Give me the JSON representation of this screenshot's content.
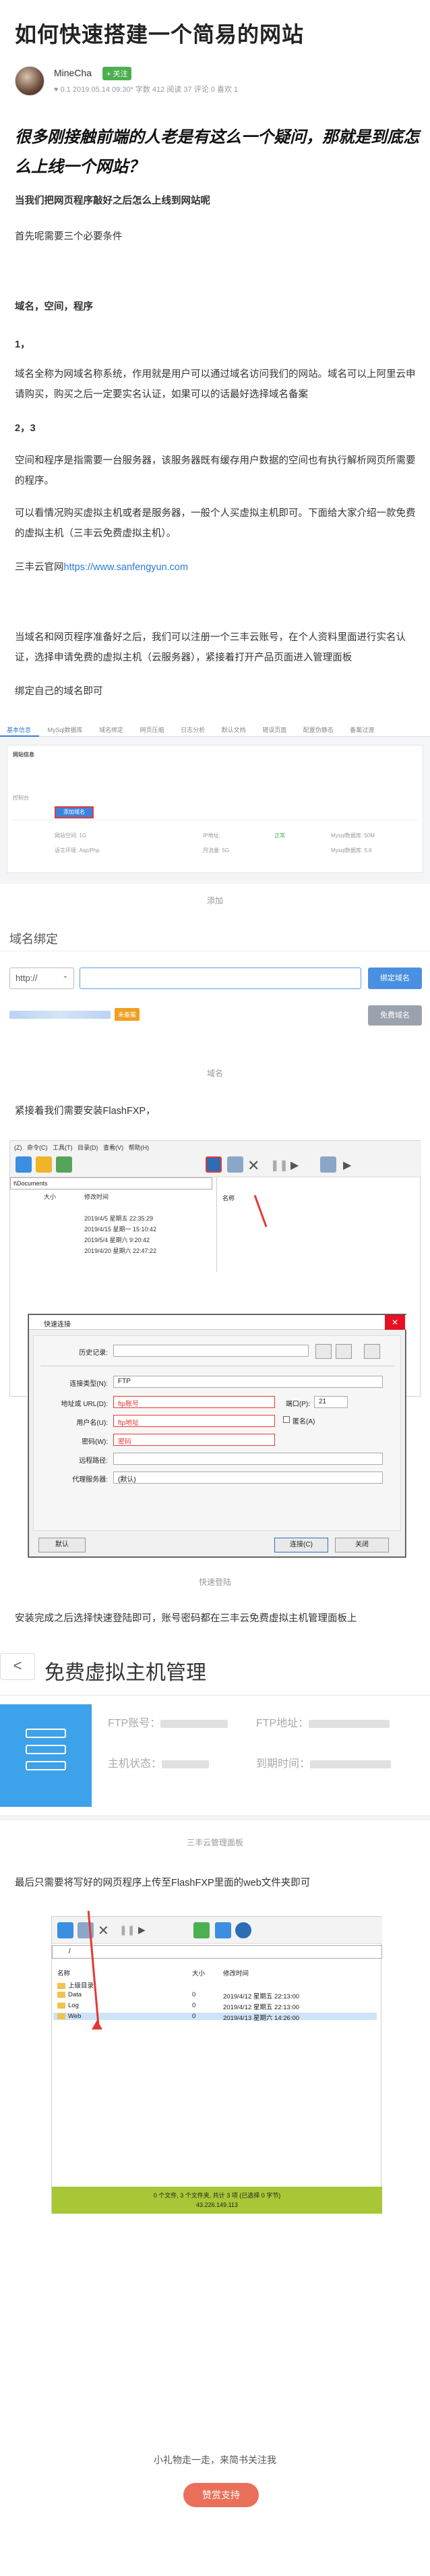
{
  "article": {
    "title": "如何快速搭建一个简易的网站",
    "author": "MineCha",
    "follow_label": "+ 关注",
    "meta": "♥ 0.1  2019.05.14 09:30* 字数 412  阅读 37 评论 0 喜欢 1",
    "lead": "很多刚接触前端的人老是有这么一个疑问，那就是到底怎么上线一个网站？",
    "subhead": "当我们把网页程序敲好之后怎么上线到网站呢",
    "p_need": "首先呢需要三个必要条件",
    "p_list": "域名，空间，程序",
    "p_1": "1，",
    "p_domain": "域名全称为网域名称系统，作用就是用户可以通过域名访问我们的网站。域名可以上阿里云申请购买，购买之后一定要实名认证，如果可以的话最好选择域名备案",
    "p_23": "2，3",
    "p_space": "空间和程序是指需要一台服务器，该服务器既有缓存用户数据的空间也有执行解析网页所需要的程序。",
    "p_vhost": "可以看情况购买虚拟主机或者是服务器，一般个人买虚拟主机即可。下面给大家介绍一款免费的虚拟主机（三丰云免费虚拟主机）。",
    "p_site_label": "三丰云官网",
    "p_site_url": "https://www.sanfengyun.com",
    "p_ready": "当域名和网页程序准备好之后，我们可以注册一个三丰云账号，在个人资料里面进行实名认证，选择申请免费的虚拟主机（云服务器），紧接着打开产品页面进入管理面板",
    "p_bind": "绑定自己的域名即可",
    "cap_add": "添加",
    "cap_domain": "域名",
    "p_install": "紧接着我们需要安装FlashFXP，",
    "cap_quick": "快速登陆",
    "p_after": "安装完成之后选择快速登陆即可，账号密码都在三丰云免费虚拟主机管理面板上",
    "cap_panel": "三丰云管理面板",
    "p_upload": "最后只需要将写好的网页程序上传至FlashFXP里面的web文件夹即可",
    "gift": "小礼物走一走，来简书关注我",
    "tip_button": "赞赏支持"
  },
  "panel_screenshot": {
    "tabs": [
      "基本信息",
      "MySql数据库",
      "域名绑定",
      "网页压缩",
      "日志分析",
      "默认文档",
      "错误页面",
      "配置伪静态",
      "备案过渡"
    ],
    "active_tab": "基本信息",
    "labels": {
      "site_info": "网站信息",
      "console": "控制台",
      "domain_size": "网站空间: 1G",
      "ip": "IP地址:",
      "mysql": "Mysql数据库: 50M",
      "runtime": "语言环境: Asp/Php",
      "bandwidth": "月流量: 5G",
      "mysql_ver": "Mysql数据库: 5.6"
    },
    "button": "添加域名",
    "status": "正常"
  },
  "domain_bind": {
    "title": "域名绑定",
    "protocol": "http://",
    "bind_button": "绑定域名",
    "badge": "未备案",
    "free_button": "免费域名"
  },
  "flashfxp": {
    "menu": [
      "(Z)",
      "命令(C)",
      "工具(T)",
      "目录(D)",
      "查看(V)",
      "帮助(H)"
    ],
    "path": "t\\Documents",
    "col_size": "大小",
    "col_date": "修改时间",
    "rows": [
      "2019/4/5 星期五 22:35:29",
      "2019/4/15 星期一 15:10:42",
      "2019/5/4 星期六 9:20:42",
      "2019/4/20 星期六 22:47:22"
    ],
    "right_col": "名称"
  },
  "quick_dialog": {
    "title": "快速连接",
    "history": "历史记录:",
    "server_type_label": "连接类型(N):",
    "server_type": "FTP",
    "address_label": "地址或 URL(D):",
    "address": "ftp账号",
    "port_label": "端口(P):",
    "port": "21",
    "user_label": "用户名(U):",
    "user": "ftp地址",
    "anon": "匿名(A)",
    "pass_label": "密码(W):",
    "pass": "密码",
    "remote_label": "远程路径:",
    "proxy_label": "代理服务器:",
    "proxy": "(默认)",
    "default_btn": "默认",
    "connect_btn": "连接(C)",
    "close_btn": "关闭"
  },
  "free_host": {
    "back": "<",
    "title": "免费虚拟主机管理",
    "ftp_user": "FTP账号：",
    "ftp_addr": "FTP地址：",
    "status": "主机状态：",
    "expire": "到期时间："
  },
  "fxp2": {
    "path": "/",
    "col_name": "名称",
    "col_size": "大小",
    "col_date": "修改时间",
    "files": [
      {
        "name": "上级目录",
        "size": "",
        "date": ""
      },
      {
        "name": "Data",
        "size": "0",
        "date": "2019/4/12 星期五 22:13:00"
      },
      {
        "name": "Log",
        "size": "0",
        "date": "2019/4/12 星期五 22:13:00"
      },
      {
        "name": "Web",
        "size": "0",
        "date": "2019/4/13 星期六 14:26:00"
      }
    ],
    "status": "0 个文件, 3 个文件夹, 共计 3 项 (已选择 0 字节)",
    "ip": "43.226.149.113"
  },
  "colors": {
    "accent": "#3a7bd5",
    "red": "#e53935",
    "tip": "#ea6f5a",
    "green": "#4caf50"
  }
}
